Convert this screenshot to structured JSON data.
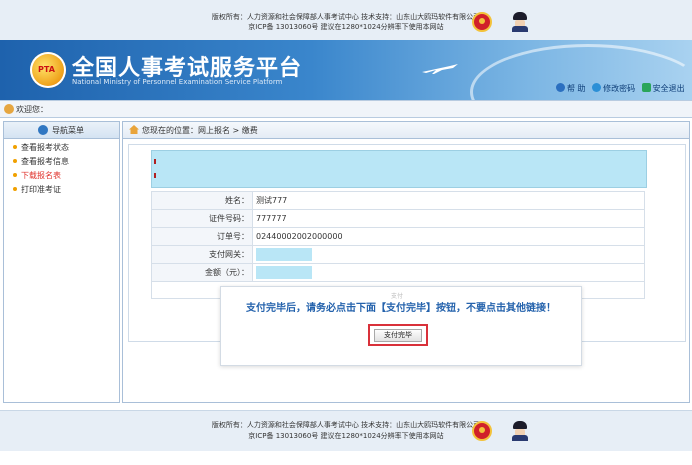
{
  "top_footer": {
    "copyright_line": "版权所有：人力资源和社会保障部人事考试中心  技术支持：山东山大鸥玛软件有限公司",
    "icp_line": "京ICP备 13013060号  建议在1280*1024分辨率下使用本网站"
  },
  "header": {
    "title": "全国人事考试服务平台",
    "subtitle": "National Ministry of Personnel Examination Service Platform",
    "logo_text": "PTA",
    "links": [
      {
        "label": "帮 助"
      },
      {
        "label": "修改密码"
      },
      {
        "label": "安全退出"
      }
    ]
  },
  "welcome": {
    "text": "欢迎您："
  },
  "sidebar": {
    "title": "导航菜单",
    "items": [
      {
        "label": "查看报考状态",
        "active": false
      },
      {
        "label": "查看报考信息",
        "active": false
      },
      {
        "label": "下载报名表",
        "active": true
      },
      {
        "label": "打印准考证",
        "active": false
      }
    ]
  },
  "breadcrumb": {
    "text": "您现在的位置：网上报名 > 缴费"
  },
  "info": {
    "rows": [
      {
        "label": "姓名：",
        "value": "测试777"
      },
      {
        "label": "证件号码：",
        "value": "777777"
      },
      {
        "label": "订单号：",
        "value": "02440002002000000"
      },
      {
        "label": "支付网关：",
        "value": ""
      },
      {
        "label": "金额（元）：",
        "value": ""
      }
    ]
  },
  "modal": {
    "ghost_text": "支付",
    "message": "支付完毕后，请务必点击下面【支付完毕】按钮，不要点击其他链接！",
    "button_label": "支付完毕"
  },
  "bottom_footer": {
    "copyright_line": "版权所有：人力资源和社会保障部人事考试中心  技术支持：山东山大鸥玛软件有限公司",
    "icp_line": "京ICP备 13013060号  建议在1280*1024分辨率下使用本网站"
  },
  "colors": {
    "accent": "#2462ac",
    "highlight_red": "#d9313a",
    "redaction": "#b9e6f6",
    "active_nav": "#e0322b"
  }
}
